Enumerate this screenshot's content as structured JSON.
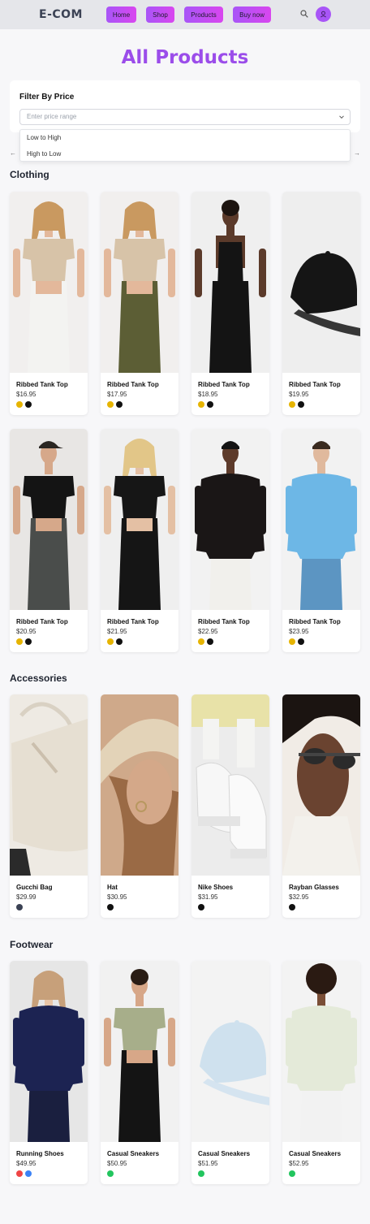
{
  "app": {
    "brand": "E-COM"
  },
  "nav": [
    {
      "label": "Home"
    },
    {
      "label": "Shop"
    },
    {
      "label": "Products"
    },
    {
      "label": "Buy now"
    }
  ],
  "header_icons": {
    "search": "search-icon",
    "avatar": "user-avatar-icon"
  },
  "page": {
    "title": "All Products"
  },
  "filter": {
    "title": "Filter By Price",
    "placeholder": "Enter price range",
    "options": [
      "Low to High",
      "High to Low"
    ],
    "prev_arrow": "←",
    "next_arrow": "→"
  },
  "sections": [
    {
      "title": "Clothing",
      "products": [
        {
          "name": "Ribbed Tank Top",
          "price": "$16.95",
          "colors": [
            "#e6b400",
            "#111111"
          ],
          "image": "woman-beige-top-white-pants"
        },
        {
          "name": "Ribbed Tank Top",
          "price": "$17.95",
          "colors": [
            "#e6b400",
            "#111111"
          ],
          "image": "woman-beige-top-olive-pants"
        },
        {
          "name": "Ribbed Tank Top",
          "price": "$18.95",
          "colors": [
            "#e6b400",
            "#111111"
          ],
          "image": "woman-black-tank"
        },
        {
          "name": "Ribbed Tank Top",
          "price": "$19.95",
          "colors": [
            "#e6b400",
            "#111111"
          ],
          "image": "black-cap"
        },
        {
          "name": "Ribbed Tank Top",
          "price": "$20.95",
          "colors": [
            "#e6b400",
            "#111111"
          ],
          "image": "woman-black-tee-grey-pants"
        },
        {
          "name": "Ribbed Tank Top",
          "price": "$21.95",
          "colors": [
            "#e6b400",
            "#111111"
          ],
          "image": "woman-black-tee-shorts"
        },
        {
          "name": "Ribbed Tank Top",
          "price": "$22.95",
          "colors": [
            "#e6b400",
            "#111111"
          ],
          "image": "man-black-sweatshirt"
        },
        {
          "name": "Ribbed Tank Top",
          "price": "$23.95",
          "colors": [
            "#e6b400",
            "#111111"
          ],
          "image": "man-blue-sweatshirt"
        }
      ]
    },
    {
      "title": "Accessories",
      "products": [
        {
          "name": "Gucchi Bag",
          "price": "$29.99",
          "colors": [
            "#3b4254"
          ],
          "image": "beige-bag"
        },
        {
          "name": "Hat",
          "price": "$30.95",
          "colors": [
            "#111111"
          ],
          "image": "straw-hat"
        },
        {
          "name": "Nike Shoes",
          "price": "$31.95",
          "colors": [
            "#111111"
          ],
          "image": "white-sneakers"
        },
        {
          "name": "Rayban Glasses",
          "price": "$32.95",
          "colors": [
            "#111111"
          ],
          "image": "sunglasses"
        }
      ]
    },
    {
      "title": "Footwear",
      "products": [
        {
          "name": "Running Shoes",
          "price": "$49.95",
          "colors": [
            "#ef4444",
            "#3b82f6"
          ],
          "image": "man-navy-sweatshirt"
        },
        {
          "name": "Casual Sneakers",
          "price": "$50.95",
          "colors": [
            "#22c55e"
          ],
          "image": "woman-sage-tee"
        },
        {
          "name": "Casual Sneakers",
          "price": "$51.95",
          "colors": [
            "#22c55e"
          ],
          "image": "light-blue-cap"
        },
        {
          "name": "Casual Sneakers",
          "price": "$52.95",
          "colors": [
            "#22c55e"
          ],
          "image": "man-sage-sweatshirt"
        }
      ]
    }
  ]
}
